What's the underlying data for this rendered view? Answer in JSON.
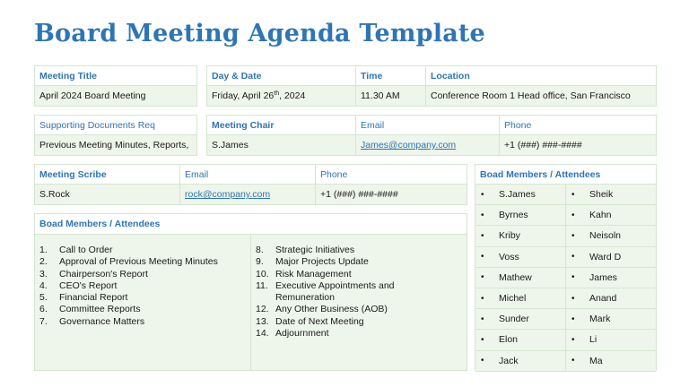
{
  "title": "Board Meeting Agenda Template",
  "meeting": {
    "title_label": "Meeting Title",
    "title_value": "April  2024 Board Meeting",
    "date_label": "Day & Date",
    "date_value_pre": "Friday, April 26",
    "date_value_sup": "th",
    "date_value_post": ", 2024",
    "time_label": "Time",
    "time_value": "11.30 AM",
    "location_label": "Location",
    "location_value": "Conference Room 1 Head office, San Francisco"
  },
  "docs": {
    "label": "Supporting Documents Req",
    "value": "Previous Meeting Minutes, Reports,"
  },
  "chair": {
    "label": "Meeting Chair",
    "value": "S.James",
    "email_label": "Email",
    "email_value": "James@company.com",
    "phone_label": "Phone",
    "phone_value": "+1 (###) ###-####"
  },
  "scribe": {
    "label": "Meeting Scribe",
    "value": "S.Rock",
    "email_label": "Email",
    "email_value": "rock@company.com",
    "phone_label": "Phone",
    "phone_value": "+1 (###) ###-####"
  },
  "agenda": {
    "label": "Boad Members / Attendees",
    "left": [
      {
        "n": "1.",
        "t": "Call to Order"
      },
      {
        "n": "2.",
        "t": "Approval of Previous Meeting Minutes"
      },
      {
        "n": "3.",
        "t": "Chairperson's Report"
      },
      {
        "n": "4.",
        "t": "CEO's Report"
      },
      {
        "n": "5.",
        "t": "Financial Report"
      },
      {
        "n": "6.",
        "t": "Committee Reports"
      },
      {
        "n": "7.",
        "t": "Governance Matters"
      }
    ],
    "right": [
      {
        "n": "8.",
        "t": "Strategic Initiatives"
      },
      {
        "n": "9.",
        "t": "Major Projects Update"
      },
      {
        "n": "10.",
        "t": "Risk Management"
      },
      {
        "n": "11.",
        "t": "Executive Appointments and"
      },
      {
        "n": "",
        "t": "Remuneration"
      },
      {
        "n": "12.",
        "t": "Any Other Business (AOB)"
      },
      {
        "n": "13.",
        "t": "Date of Next Meeting"
      },
      {
        "n": "14.",
        "t": "Adjournment"
      }
    ]
  },
  "attendees": {
    "label": "Boad Members / Attendees",
    "bullet": "•",
    "rows": [
      [
        "S.James",
        "Sheik"
      ],
      [
        "Byrnes",
        "Kahn"
      ],
      [
        "Kriby",
        "Neisoln"
      ],
      [
        "Voss",
        "Ward D"
      ],
      [
        "Mathew",
        "James"
      ],
      [
        "Michel",
        "Anand"
      ],
      [
        "Sunder",
        "Mark"
      ],
      [
        "Elon",
        "Li"
      ],
      [
        "Jack",
        "Ma"
      ]
    ]
  }
}
